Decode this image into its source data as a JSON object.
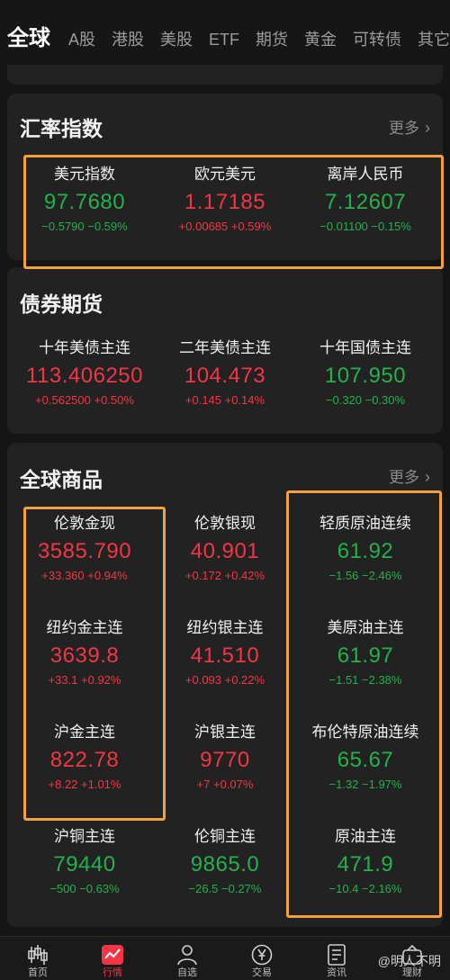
{
  "nav": {
    "tabs": [
      {
        "label": "全球",
        "active": true
      },
      {
        "label": "A股"
      },
      {
        "label": "港股"
      },
      {
        "label": "美股"
      },
      {
        "label": "ETF"
      },
      {
        "label": "期货"
      },
      {
        "label": "黄金"
      },
      {
        "label": "可转债"
      },
      {
        "label": "其它"
      }
    ]
  },
  "colors": {
    "up": "#f23645",
    "down": "#22b24c",
    "highlight": "#f4a13b"
  },
  "fx": {
    "title": "汇率指数",
    "more": "更多",
    "items": [
      {
        "name": "美元指数",
        "price": "97.7680",
        "change": "−0.5790  −0.59%",
        "dir": "down"
      },
      {
        "name": "欧元美元",
        "price": "1.17185",
        "change": "+0.00685  +0.59%",
        "dir": "up"
      },
      {
        "name": "离岸人民币",
        "price": "7.12607",
        "change": "−0.01100  −0.15%",
        "dir": "down"
      }
    ]
  },
  "bonds": {
    "title": "债券期货",
    "items": [
      {
        "name": "十年美债主连",
        "price": "113.406250",
        "change": "+0.562500  +0.50%",
        "dir": "up"
      },
      {
        "name": "二年美债主连",
        "price": "104.473",
        "change": "+0.145  +0.14%",
        "dir": "up"
      },
      {
        "name": "十年国债主连",
        "price": "107.950",
        "change": "−0.320  −0.30%",
        "dir": "down"
      }
    ]
  },
  "commodities": {
    "title": "全球商品",
    "more": "更多",
    "items": [
      {
        "name": "伦敦金现",
        "price": "3585.790",
        "change": "+33.360  +0.94%",
        "dir": "up"
      },
      {
        "name": "伦敦银现",
        "price": "40.901",
        "change": "+0.172  +0.42%",
        "dir": "up"
      },
      {
        "name": "轻质原油连续",
        "price": "61.92",
        "change": "−1.56  −2.46%",
        "dir": "down"
      },
      {
        "name": "纽约金主连",
        "price": "3639.8",
        "change": "+33.1  +0.92%",
        "dir": "up"
      },
      {
        "name": "纽约银主连",
        "price": "41.510",
        "change": "+0.093  +0.22%",
        "dir": "up"
      },
      {
        "name": "美原油主连",
        "price": "61.97",
        "change": "−1.51  −2.38%",
        "dir": "down"
      },
      {
        "name": "沪金主连",
        "price": "822.78",
        "change": "+8.22  +1.01%",
        "dir": "up"
      },
      {
        "name": "沪银主连",
        "price": "9770",
        "change": "+7  +0.07%",
        "dir": "up"
      },
      {
        "name": "布伦特原油连续",
        "price": "65.67",
        "change": "−1.32  −1.97%",
        "dir": "down"
      },
      {
        "name": "沪铜主连",
        "price": "79440",
        "change": "−500  −0.63%",
        "dir": "down"
      },
      {
        "name": "伦铜主连",
        "price": "9865.0",
        "change": "−26.5  −0.27%",
        "dir": "down"
      },
      {
        "name": "原油主连",
        "price": "471.9",
        "change": "−10.4  −2.16%",
        "dir": "down"
      }
    ]
  },
  "bottom_nav": {
    "items": [
      {
        "label": "首页",
        "icon": "candlestick-icon"
      },
      {
        "label": "行情",
        "icon": "market-chart-icon",
        "active": true
      },
      {
        "label": "自选",
        "icon": "user-star-icon"
      },
      {
        "label": "交易",
        "icon": "yen-coin-icon"
      },
      {
        "label": "资讯",
        "icon": "news-doc-icon"
      },
      {
        "label": "理财",
        "icon": "wallet-icon"
      }
    ]
  },
  "watermark": "@明人不明"
}
